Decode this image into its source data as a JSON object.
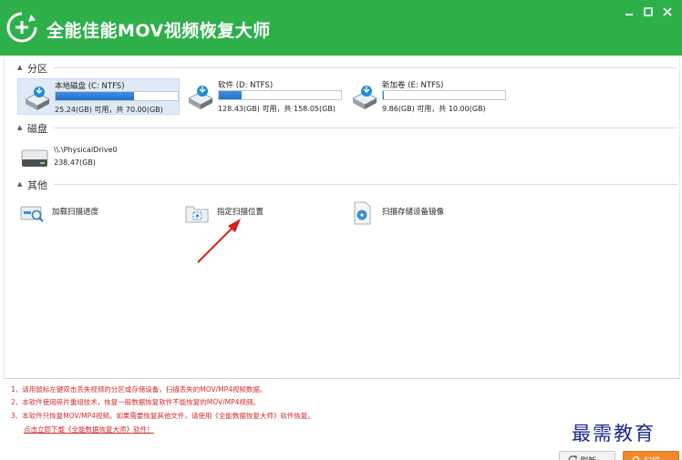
{
  "app": {
    "title": "全能佳能MOV视频恢复大师"
  },
  "window_controls": [
    "minimize",
    "maximize",
    "close"
  ],
  "sections": {
    "partitions": "分区",
    "disks": "磁盘",
    "others": "其他"
  },
  "partitions": [
    {
      "name": "本地磁盘 (C: NTFS)",
      "size": "25.24(GB) 可用，共 70.00(GB)",
      "used_fraction": 0.64,
      "selected": true
    },
    {
      "name": "软件 (D: NTFS)",
      "size": "128.43(GB) 可用，共 158.05(GB)",
      "used_fraction": 0.19,
      "selected": false
    },
    {
      "name": "新加卷 (E: NTFS)",
      "size": "9.86(GB) 可用，共 10.00(GB)",
      "used_fraction": 0.01,
      "selected": false
    }
  ],
  "disks": [
    {
      "name": "\\\\.\\PhysicalDrive0",
      "size": "238.47(GB)"
    }
  ],
  "tools": [
    {
      "label": "加载扫描进度",
      "icon": "load-progress-icon"
    },
    {
      "label": "指定扫描位置",
      "icon": "scan-location-icon"
    },
    {
      "label": "扫描存储设备镜像",
      "icon": "disk-image-icon"
    }
  ],
  "tips": [
    "1、请用鼠标左键双击丢失视频的分区或存储设备，扫描丢失的MOV/MP4视频数据。",
    "2、本软件使用碎片重组技术，恢复一般数据恢复软件不能恢复的MOV/MP4视频。",
    "3、本软件只恢复MOV/MP4视频。如果需要恢复其他文件，请使用《全能数据恢复大师》软件恢复。",
    "点击立即下载《全能数据恢复大师》软件！"
  ],
  "watermark": "最需教育",
  "buttons": {
    "refresh": "刷新",
    "scan": "扫描"
  },
  "colors": {
    "titlebar": "#2db04a",
    "tip_text": "#d12a2a",
    "scan_button": "#f08a2a",
    "arrow": "#d42020"
  }
}
